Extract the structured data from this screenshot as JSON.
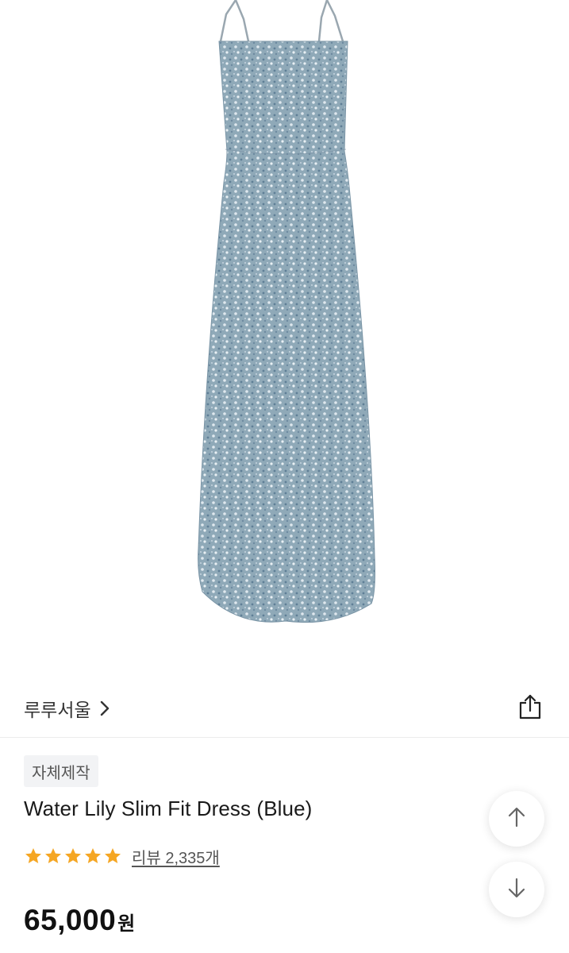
{
  "product_image": {
    "alt": "Water Lily Slim Fit Dress (Blue)",
    "dress_color": "#8fa9b8"
  },
  "brand": {
    "name": "루루서울",
    "chevron_icon": "chevron-right-icon"
  },
  "share": {
    "icon": "share-icon"
  },
  "badge": {
    "label": "자체제작"
  },
  "product": {
    "name": "Water Lily Slim Fit Dress (Blue)",
    "rating_stars": 5,
    "review_label": "리뷰 2,335개",
    "price": "65,000",
    "price_unit": "원"
  },
  "scroll_buttons": {
    "up_icon": "arrow-up-icon",
    "down_icon": "arrow-down-icon"
  },
  "colors": {
    "star": "#f5a623",
    "text": "#111111",
    "muted": "#555555"
  }
}
